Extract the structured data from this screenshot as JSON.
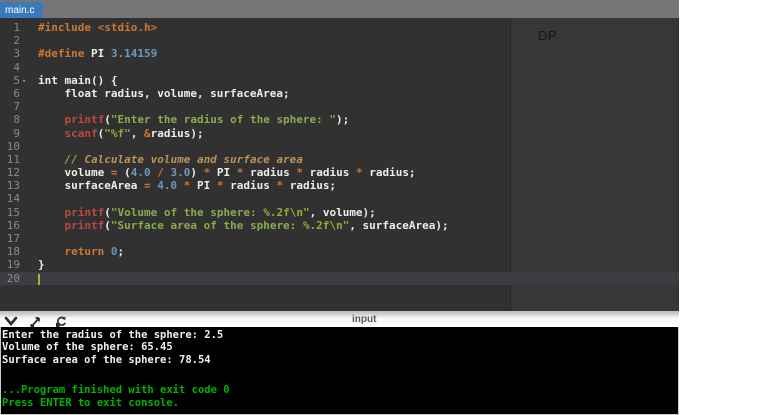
{
  "tab_bar": {
    "tabs": [
      {
        "label": "main.c",
        "active": true
      }
    ]
  },
  "editor": {
    "watermark": "DP",
    "cursor_line": 20,
    "fold_lines": [
      5
    ],
    "lines": [
      [
        [
          "k",
          "#include <stdio.h>"
        ]
      ],
      [],
      [
        [
          "k",
          "#define"
        ],
        [
          "p",
          " PI "
        ],
        [
          "n",
          "3.14159"
        ]
      ],
      [],
      [
        [
          "p",
          "int main() {"
        ]
      ],
      [
        [
          "p",
          "    float radius, volume, surfaceArea;"
        ]
      ],
      [],
      [
        [
          "p",
          "    "
        ],
        [
          "f",
          "printf"
        ],
        [
          "p",
          "("
        ],
        [
          "s",
          "\"Enter the radius of the sphere: \""
        ],
        [
          "p",
          ");"
        ]
      ],
      [
        [
          "p",
          "    "
        ],
        [
          "f",
          "scanf"
        ],
        [
          "p",
          "("
        ],
        [
          "s",
          "\""
        ],
        [
          "m",
          "%f"
        ],
        [
          "s",
          "\""
        ],
        [
          "p",
          ", "
        ],
        [
          "o",
          "&"
        ],
        [
          "p",
          "radius);"
        ]
      ],
      [],
      [
        [
          "c",
          "    // Calculate volume and surface area"
        ]
      ],
      [
        [
          "p",
          "    volume "
        ],
        [
          "o",
          "="
        ],
        [
          "p",
          " ("
        ],
        [
          "n",
          "4.0"
        ],
        [
          "p",
          " "
        ],
        [
          "o",
          "/"
        ],
        [
          "p",
          " "
        ],
        [
          "n",
          "3.0"
        ],
        [
          "p",
          ") "
        ],
        [
          "o",
          "*"
        ],
        [
          "p",
          " PI "
        ],
        [
          "o",
          "*"
        ],
        [
          "p",
          " radius "
        ],
        [
          "o",
          "*"
        ],
        [
          "p",
          " radius "
        ],
        [
          "o",
          "*"
        ],
        [
          "p",
          " radius;"
        ]
      ],
      [
        [
          "p",
          "    surfaceArea "
        ],
        [
          "o",
          "="
        ],
        [
          "p",
          " "
        ],
        [
          "n",
          "4.0"
        ],
        [
          "p",
          " "
        ],
        [
          "o",
          "*"
        ],
        [
          "p",
          " PI "
        ],
        [
          "o",
          "*"
        ],
        [
          "p",
          " radius "
        ],
        [
          "o",
          "*"
        ],
        [
          "p",
          " radius;"
        ]
      ],
      [],
      [
        [
          "p",
          "    "
        ],
        [
          "f",
          "printf"
        ],
        [
          "p",
          "("
        ],
        [
          "s",
          "\"Volume of the sphere: "
        ],
        [
          "m",
          "%.2f\\n"
        ],
        [
          "s",
          "\""
        ],
        [
          "p",
          ", volume);"
        ]
      ],
      [
        [
          "p",
          "    "
        ],
        [
          "f",
          "printf"
        ],
        [
          "p",
          "("
        ],
        [
          "s",
          "\"Surface area of the sphere: "
        ],
        [
          "m",
          "%.2f\\n"
        ],
        [
          "s",
          "\""
        ],
        [
          "p",
          ", surfaceArea);"
        ]
      ],
      [],
      [
        [
          "p",
          "    "
        ],
        [
          "k",
          "return"
        ],
        [
          "p",
          " "
        ],
        [
          "n",
          "0"
        ],
        [
          "p",
          ";"
        ]
      ],
      [
        [
          "p",
          "}"
        ]
      ],
      []
    ]
  },
  "colors": {
    "tab_active": "#3a7abb",
    "tabbar_bg": "#767676",
    "editor_bg": "#313131",
    "keyword": "#cc7833",
    "function": "#bc4a3f",
    "string": "#8bab4f",
    "format_spec": "#a2a638",
    "number": "#6c99bb",
    "comment": "#bc9458",
    "plain_text": "#eeeee8",
    "console_success": "#00b400"
  },
  "console_toolbar": {
    "input_label": "input",
    "icons": [
      "collapse-console",
      "resize-console",
      "restart-program"
    ]
  },
  "console": {
    "lines": [
      [
        "w",
        "Enter the radius of the sphere: 2.5"
      ],
      [
        "w",
        "Volume of the sphere: 65.45"
      ],
      [
        "w",
        "Surface area of the sphere: 78.54"
      ],
      [
        "e",
        ""
      ],
      [
        "e",
        ""
      ],
      [
        "g",
        "...Program finished with exit code 0"
      ],
      [
        "g",
        "Press ENTER to exit console."
      ]
    ]
  }
}
